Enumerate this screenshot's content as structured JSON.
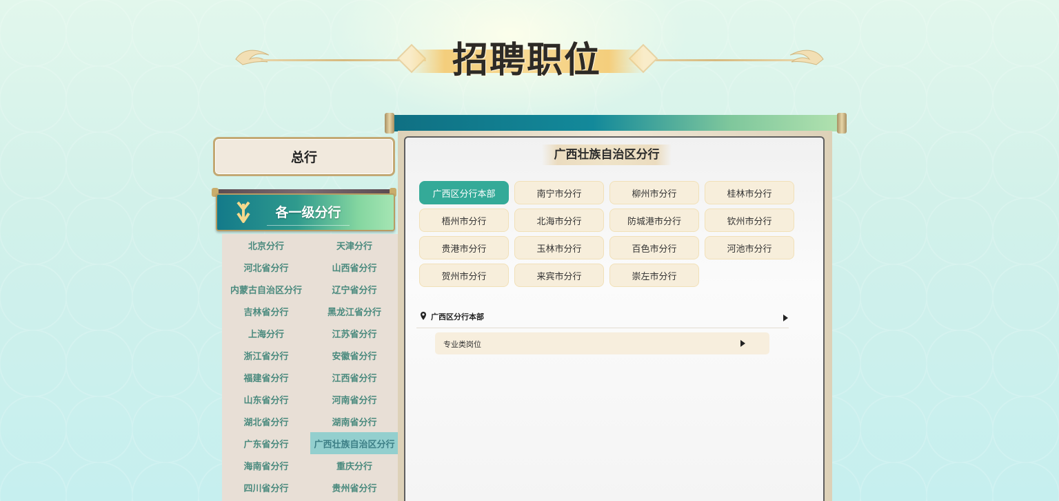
{
  "page": {
    "title": "招聘职位"
  },
  "left": {
    "hq_label": "总行",
    "branch_header_label": "各一级分行",
    "branches": [
      "北京分行",
      "天津分行",
      "河北省分行",
      "山西省分行",
      "内蒙古自治区分行",
      "辽宁省分行",
      "吉林省分行",
      "黑龙江省分行",
      "上海分行",
      "江苏省分行",
      "浙江省分行",
      "安徽省分行",
      "福建省分行",
      "江西省分行",
      "山东省分行",
      "河南省分行",
      "湖北省分行",
      "湖南省分行",
      "广东省分行",
      "广西壮族自治区分行",
      "海南省分行",
      "重庆分行",
      "四川省分行",
      "贵州省分行"
    ],
    "active_branch": "广西壮族自治区分行"
  },
  "main": {
    "region_title": "广西壮族自治区分行",
    "cities": [
      "广西区分行本部",
      "南宁市分行",
      "柳州市分行",
      "桂林市分行",
      "梧州市分行",
      "北海市分行",
      "防城港市分行",
      "钦州市分行",
      "贵港市分行",
      "玉林市分行",
      "百色市分行",
      "河池市分行",
      "贺州市分行",
      "来宾市分行",
      "崇左市分行"
    ],
    "active_city": "广西区分行本部",
    "dept_label": "广西区分行本部",
    "job_label": "专业类岗位"
  },
  "colors": {
    "accent_teal": "#34aa98",
    "branch_text": "#4a8a7e",
    "active_branch_bg": "#93cfce",
    "city_btn_bg": "#f7eedb",
    "gold_border": "#c3a873"
  },
  "icons": {
    "branch_header": "double-chevron-down-icon",
    "dept": "location-pin-icon",
    "expand": "triangle-right-icon"
  }
}
